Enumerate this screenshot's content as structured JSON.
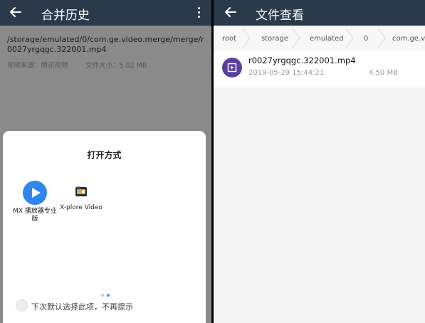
{
  "left_screen": {
    "title": "合并历史",
    "file_path": "/storage/emulated/0/com.ge.video.merge/merge/r0027yrgqgc.322001.mp4",
    "video_source": "视频来源：腾讯视频",
    "file_size": "文件大小：5.02 MB",
    "open_with_dialog": {
      "title": "打开方式",
      "apps": [
        {
          "label": "MX 播放器专业版",
          "icon": "mx-player-icon"
        },
        {
          "label": "X-plore Video",
          "icon": "x-plore-icon"
        }
      ],
      "default_checkbox_label": "下次默认选择此项，不再提示",
      "page_count": 2,
      "current_page": 2
    }
  },
  "right_screen": {
    "title": "文件查看",
    "breadcrumbs": [
      "root",
      "storage",
      "emulated",
      "0",
      "com.ge.vid"
    ],
    "files": [
      {
        "name": "r0027yrgqgc.322001.mp4",
        "date": "2019-05-29 15:44:21",
        "size": "4.50 MB",
        "icon": "video-file-icon"
      }
    ]
  },
  "colors": {
    "toolbar": "#2b3a4a",
    "mx_blue": "#2f86ec",
    "file_icon_purple": "#5b3fa0",
    "page_dot_active": "#3aa0e8",
    "page_dot_inactive": "#c8c8c8"
  }
}
